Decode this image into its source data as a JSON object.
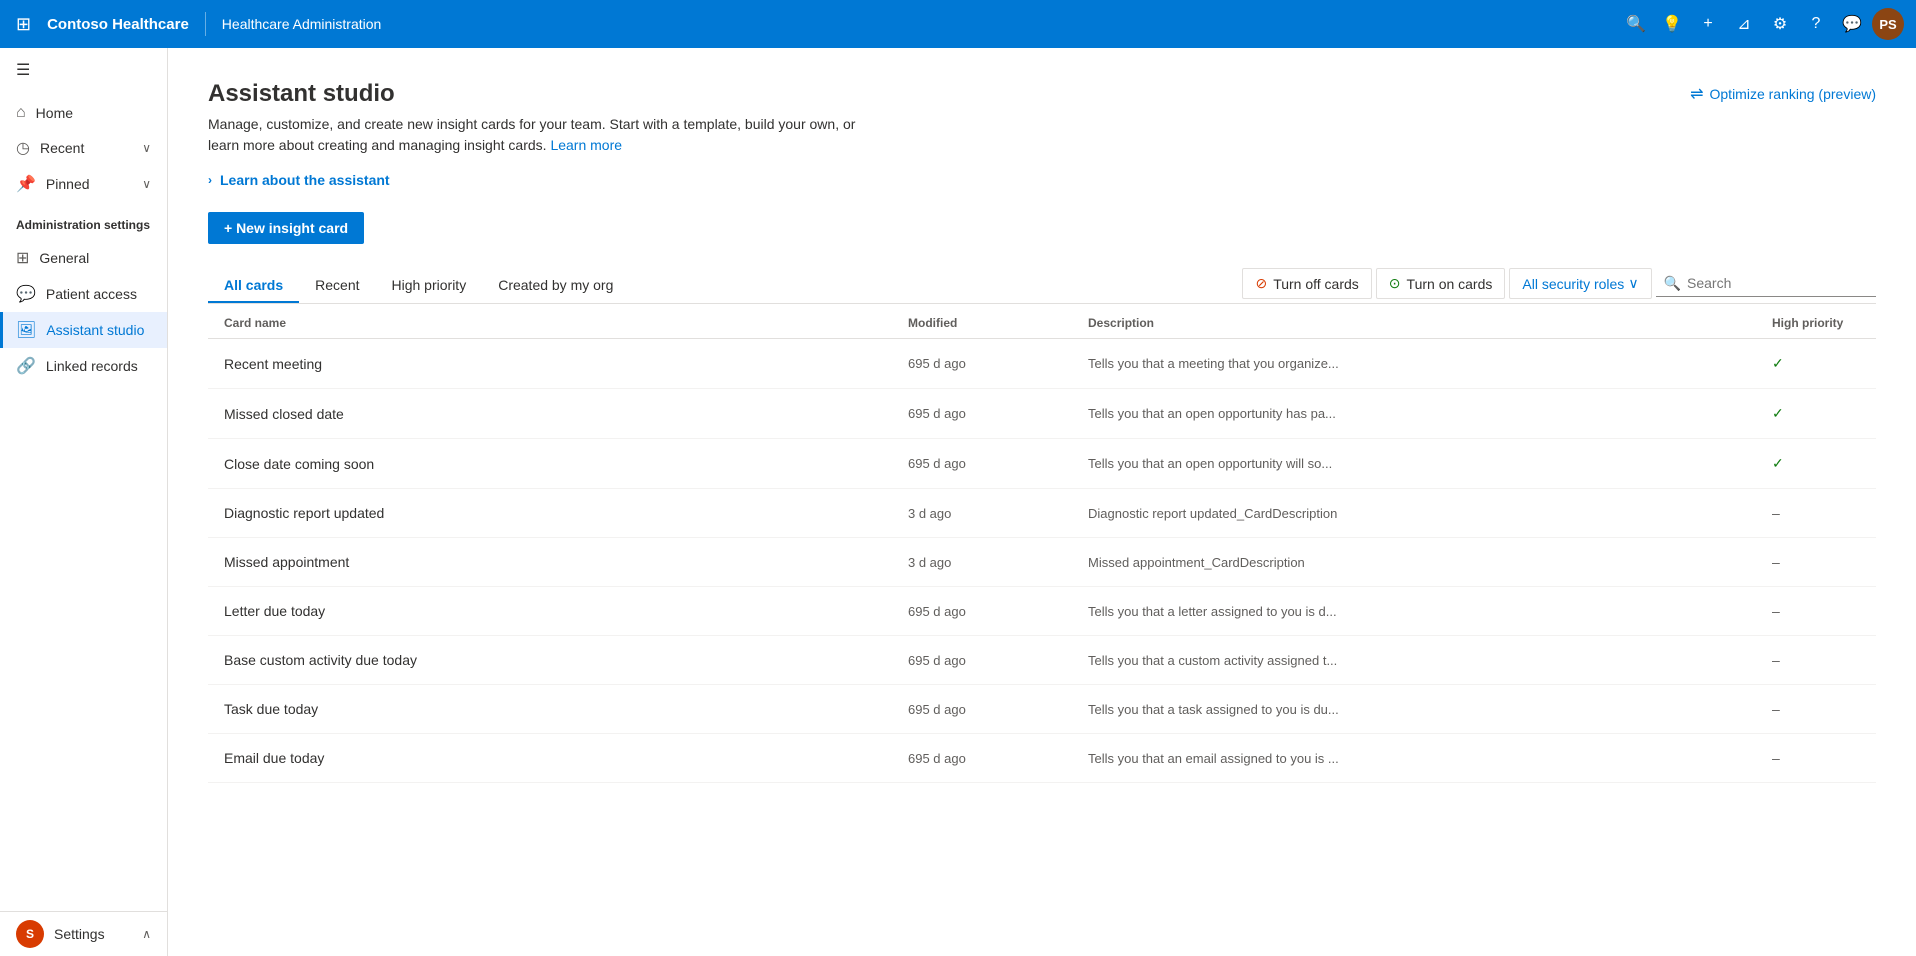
{
  "topbar": {
    "app_name": "Contoso Healthcare",
    "module_name": "Healthcare Administration",
    "avatar_initials": "PS"
  },
  "sidebar": {
    "hamburger_label": "☰",
    "nav_items": [
      {
        "id": "home",
        "label": "Home",
        "icon": "⌂",
        "has_chevron": false
      },
      {
        "id": "recent",
        "label": "Recent",
        "icon": "◷",
        "has_chevron": true
      },
      {
        "id": "pinned",
        "label": "Pinned",
        "icon": "📌",
        "has_chevron": true
      }
    ],
    "section_header": "Administration settings",
    "admin_items": [
      {
        "id": "general",
        "label": "General",
        "icon": "⊞",
        "active": false
      },
      {
        "id": "patient-access",
        "label": "Patient access",
        "icon": "💬",
        "active": false
      },
      {
        "id": "assistant-studio",
        "label": "Assistant studio",
        "icon": "🖼",
        "active": true
      },
      {
        "id": "linked-records",
        "label": "Linked records",
        "icon": "🔗",
        "active": false
      }
    ],
    "bottom": {
      "avatar_initial": "S",
      "label": "Settings",
      "chevron": "⌃"
    }
  },
  "page": {
    "title": "Assistant studio",
    "subtitle": "Manage, customize, and create new insight cards for your team. Start with a template, build your own, or learn more about creating and managing insight cards.",
    "learn_more_label": "Learn more",
    "optimize_btn": "Optimize ranking (preview)",
    "learn_section_label": "Learn about the assistant",
    "new_card_btn": "+ New insight card"
  },
  "tabs": {
    "items": [
      {
        "id": "all-cards",
        "label": "All cards",
        "active": true
      },
      {
        "id": "recent",
        "label": "Recent",
        "active": false
      },
      {
        "id": "high-priority",
        "label": "High priority",
        "active": false
      },
      {
        "id": "created-by-org",
        "label": "Created by my org",
        "active": false
      }
    ],
    "turn_off_btn": "Turn off cards",
    "turn_on_btn": "Turn on cards",
    "security_roles_btn": "All security roles",
    "search_placeholder": "Search"
  },
  "table": {
    "columns": [
      {
        "id": "card-name",
        "label": "Card name"
      },
      {
        "id": "modified",
        "label": "Modified"
      },
      {
        "id": "description",
        "label": "Description"
      },
      {
        "id": "high-priority",
        "label": "High priority"
      }
    ],
    "rows": [
      {
        "name": "Recent meeting",
        "modified": "695 d ago",
        "description": "Tells you that a meeting that you organize...",
        "priority": "check"
      },
      {
        "name": "Missed closed date",
        "modified": "695 d ago",
        "description": "Tells you that an open opportunity has pa...",
        "priority": "check"
      },
      {
        "name": "Close date coming soon",
        "modified": "695 d ago",
        "description": "Tells you that an open opportunity will so...",
        "priority": "check"
      },
      {
        "name": "Diagnostic report updated",
        "modified": "3 d ago",
        "description": "Diagnostic report updated_CardDescription",
        "priority": "dash"
      },
      {
        "name": "Missed appointment",
        "modified": "3 d ago",
        "description": "Missed appointment_CardDescription",
        "priority": "dash"
      },
      {
        "name": "Letter due today",
        "modified": "695 d ago",
        "description": "Tells you that a letter assigned to you is d...",
        "priority": "dash"
      },
      {
        "name": "Base custom activity due today",
        "modified": "695 d ago",
        "description": "Tells you that a custom activity assigned t...",
        "priority": "dash"
      },
      {
        "name": "Task due today",
        "modified": "695 d ago",
        "description": "Tells you that a task assigned to you is du...",
        "priority": "dash"
      },
      {
        "name": "Email due today",
        "modified": "695 d ago",
        "description": "Tells you that an email assigned to you is ...",
        "priority": "dash"
      }
    ]
  }
}
